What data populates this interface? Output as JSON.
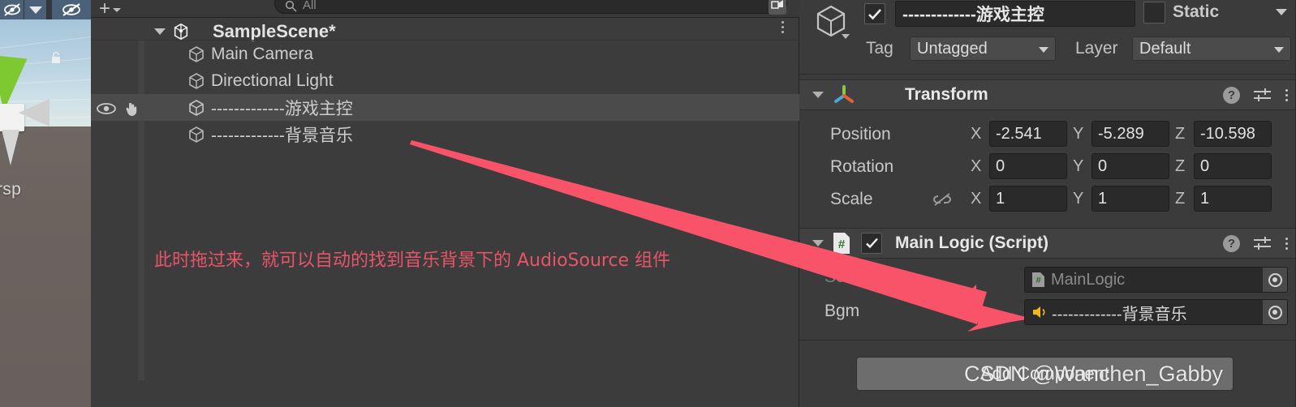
{
  "scene_view": {
    "projection_label": "ersp",
    "lock_icon": "lock-icon",
    "gizmo_icon": "transform-gizmo"
  },
  "scene_toolbar": {
    "buttons": [
      {
        "name": "shading-mode-button",
        "icon": "shaded-eye-icon"
      },
      {
        "name": "shading-dropdown-button",
        "icon": "chevron-down-icon"
      },
      {
        "name": "effects-toggle-button",
        "icon": "eye-slash-icon"
      }
    ]
  },
  "hierarchy": {
    "create_label": "+",
    "search": {
      "placeholder": "All",
      "value": "",
      "icon": "search-icon"
    },
    "lock_icon": "panel-lock-icon",
    "kebab_icon": "kebab-menu-icon",
    "scene_name": "SampleScene*",
    "items": [
      {
        "label": "Main Camera",
        "icon": "gameobject-cube-icon",
        "selected": false,
        "visibility": false
      },
      {
        "label": "Directional Light",
        "icon": "gameobject-cube-icon",
        "selected": false,
        "visibility": false
      },
      {
        "label": "-------------游戏主控",
        "icon": "gameobject-cube-icon",
        "selected": true,
        "visibility": true
      },
      {
        "label": "-------------背景音乐",
        "icon": "gameobject-cube-icon",
        "selected": false,
        "visibility": false
      }
    ],
    "annotation": "此时拖过来，就可以自动的找到音乐背景下的 AudioSource 组件"
  },
  "inspector": {
    "enabled_checked": true,
    "object_name": "-------------游戏主控",
    "static_label": "Static",
    "static_checked": false,
    "tag_label": "Tag",
    "tag_value": "Untagged",
    "layer_label": "Layer",
    "layer_value": "Default",
    "gameobject_icon": "gameobject-cube-icon",
    "components": [
      {
        "title": "Transform",
        "icon": "transform-gizmo-icon",
        "expanded": true,
        "rows": [
          {
            "label": "Position",
            "x": "-2.541 ",
            "y": "-5.289 ",
            "z": "-10.598"
          },
          {
            "label": "Rotation",
            "x": "0",
            "y": "0",
            "z": "0"
          },
          {
            "label": "Scale",
            "x": "1",
            "y": "1",
            "z": "1",
            "link_icon": "constrain-proportions-off-icon"
          }
        ]
      },
      {
        "title": "Main Logic (Script)",
        "icon": "csharp-script-icon",
        "expanded": true,
        "enabled_checked": true,
        "fields": [
          {
            "label": "Script",
            "value": "MainLogic",
            "icon": "csharp-script-icon",
            "disabled": true
          },
          {
            "label": "Bgm",
            "value": "-------------背景音乐",
            "icon": "audio-source-icon",
            "disabled": false
          }
        ]
      }
    ],
    "add_component_label": "Add Component",
    "axis_labels": {
      "x": "X",
      "y": "Y",
      "z": "Z"
    },
    "help_icon": "help-icon",
    "preset_icon": "preset-settings-icon",
    "kebab_icon": "kebab-menu-icon"
  },
  "overlay": {
    "watermark": "CSDN @Wanchen_Gabby",
    "arrow_color": "#f9536a",
    "annotation_color": "#e8546a"
  }
}
